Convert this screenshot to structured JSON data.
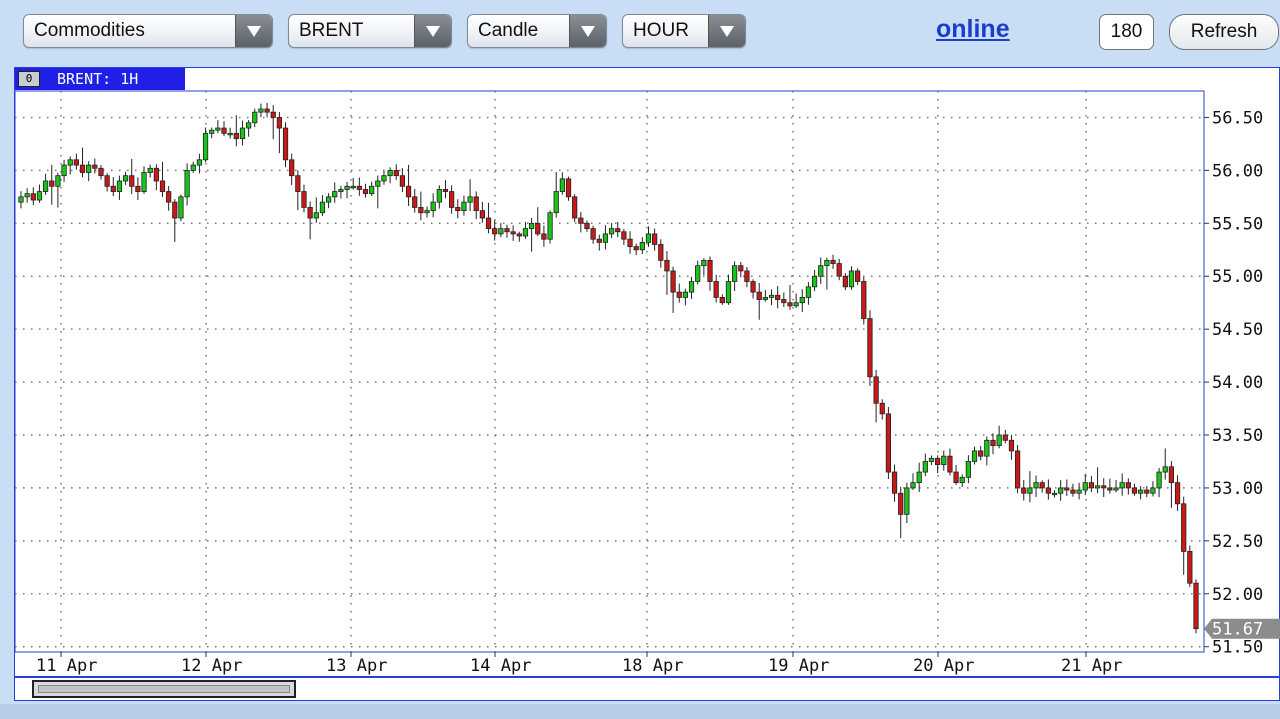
{
  "toolbar": {
    "market": "Commodities",
    "symbol": "BRENT",
    "chart_type": "Candle",
    "timeframe": "HOUR",
    "status": "online",
    "count": "180",
    "refresh_label": "Refresh"
  },
  "chart_tab": {
    "index": "0",
    "title": "BRENT: 1H"
  },
  "colors": {
    "up": "#18c418",
    "down": "#c81818",
    "grid": "#777777",
    "frame": "#2a3fd8"
  },
  "chart_data": {
    "type": "candlestick",
    "y_ticks": [
      "56.50",
      "56.00",
      "55.50",
      "55.00",
      "54.50",
      "54.00",
      "53.50",
      "53.00",
      "52.50",
      "52.00",
      "51.50"
    ],
    "x_ticks": [
      "11 Apr",
      "12 Apr",
      "13 Apr",
      "14 Apr",
      "18 Apr",
      "19 Apr",
      "20 Apr",
      "21 Apr"
    ],
    "last_price": "51.67",
    "ylim": [
      51.45,
      56.75
    ],
    "close_path": [
      55.75,
      55.78,
      55.72,
      55.8,
      55.9,
      55.85,
      55.95,
      56.05,
      56.1,
      56.05,
      55.98,
      56.05,
      56.02,
      55.95,
      55.85,
      55.8,
      55.9,
      55.95,
      55.85,
      55.8,
      55.98,
      56.02,
      55.9,
      55.8,
      55.7,
      55.55,
      55.75,
      56.0,
      56.05,
      56.1,
      56.35,
      56.38,
      56.4,
      56.35,
      56.35,
      56.3,
      56.4,
      56.45,
      56.55,
      56.58,
      56.55,
      56.5,
      56.4,
      56.1,
      55.95,
      55.8,
      55.65,
      55.55,
      55.6,
      55.7,
      55.75,
      55.8,
      55.82,
      55.85,
      55.85,
      55.82,
      55.78,
      55.85,
      55.9,
      55.95,
      56.0,
      55.95,
      55.85,
      55.75,
      55.65,
      55.6,
      55.62,
      55.7,
      55.82,
      55.8,
      55.65,
      55.62,
      55.7,
      55.75,
      55.62,
      55.55,
      55.45,
      55.4,
      55.45,
      55.42,
      55.4,
      55.38,
      55.45,
      55.5,
      55.4,
      55.35,
      55.6,
      55.8,
      55.92,
      55.75,
      55.55,
      55.5,
      55.45,
      55.35,
      55.32,
      55.4,
      55.45,
      55.42,
      55.35,
      55.28,
      55.25,
      55.32,
      55.4,
      55.3,
      55.15,
      55.05,
      54.85,
      54.8,
      54.85,
      54.95,
      55.1,
      55.15,
      54.95,
      54.8,
      54.75,
      54.95,
      55.1,
      55.05,
      54.95,
      54.85,
      54.78,
      54.8,
      54.82,
      54.78,
      54.75,
      54.72,
      54.75,
      54.8,
      54.9,
      55.0,
      55.1,
      55.15,
      55.12,
      55.0,
      54.9,
      55.05,
      54.95,
      54.6,
      54.05,
      53.8,
      53.7,
      53.15,
      52.95,
      52.75,
      53.0,
      53.05,
      53.15,
      53.25,
      53.28,
      53.22,
      53.3,
      53.15,
      53.05,
      53.1,
      53.25,
      53.35,
      53.3,
      53.45,
      53.4,
      53.5,
      53.45,
      53.35,
      53.0,
      52.95,
      53.0,
      53.05,
      53.0,
      52.95,
      52.95,
      53.0,
      52.98,
      52.95,
      52.98,
      53.05,
      53.0,
      53.02,
      53.0,
      52.98,
      53.0,
      53.05,
      53.0,
      52.95,
      52.98,
      52.95,
      53.0,
      53.15,
      53.2,
      53.05,
      52.85,
      52.4,
      52.1,
      51.67
    ]
  }
}
